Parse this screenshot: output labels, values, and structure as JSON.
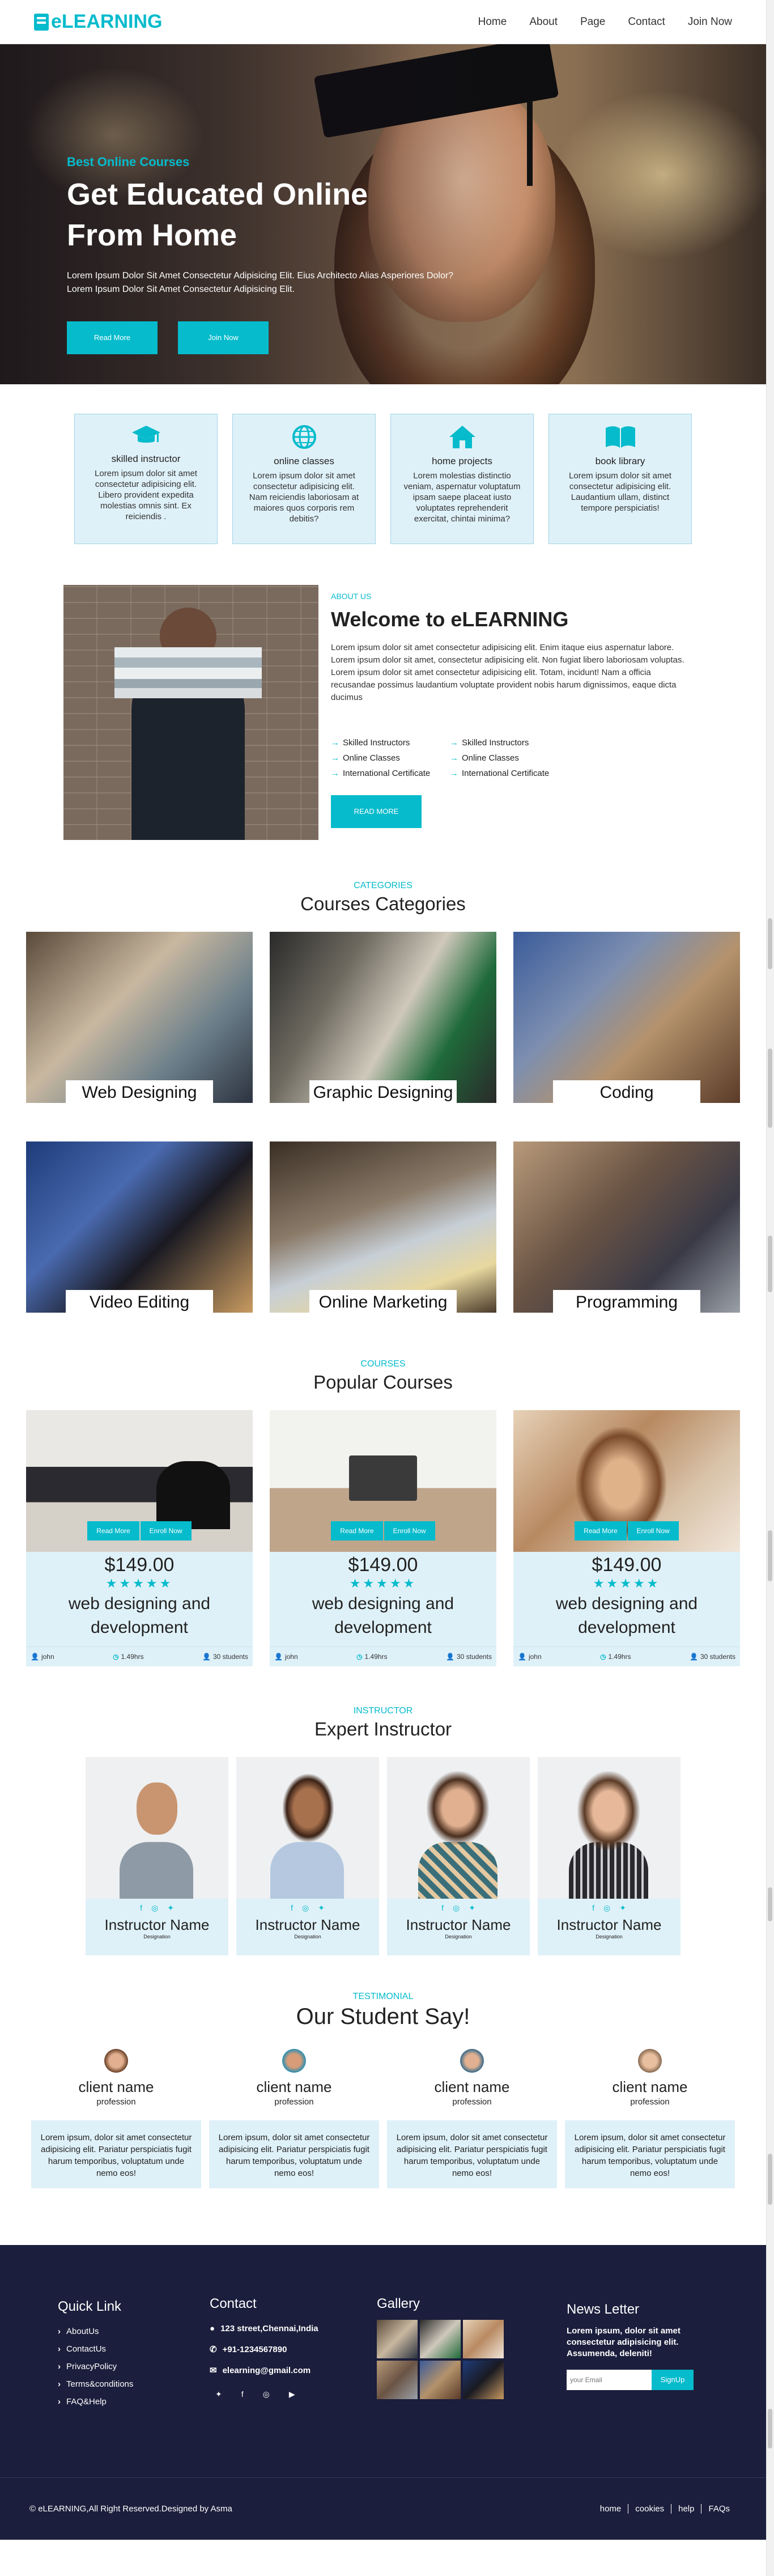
{
  "brand": "eLEARNING",
  "nav": [
    "Home",
    "About",
    "Page",
    "Contact",
    "Join Now"
  ],
  "hero": {
    "sub": "Best Online Courses",
    "title1": "Get Educated Online",
    "title2": "From Home",
    "text": "Lorem Ipsum Dolor Sit Amet Consectetur Adipisicing Elit. Eius Architecto Alias Asperiores Dolor? Lorem Ipsum Dolor Sit Amet Consectetur Adipisicing Elit.",
    "btn1": "Read More",
    "btn2": "Join Now"
  },
  "features": [
    {
      "icon": "graduation-cap-icon",
      "title": "skilled instructor",
      "text": "Lorem ipsum dolor sit amet consectetur adipisicing elit. Libero provident expedita molestias omnis sint. Ex reiciendis ."
    },
    {
      "icon": "globe-icon",
      "title": "online classes",
      "text": "Lorem ipsum dolor sit amet consectetur adipisicing elit. Nam reiciendis laboriosam at maiores quos corporis rem debitis?"
    },
    {
      "icon": "home-icon",
      "title": "home projects",
      "text": "Lorem molestias distinctio veniam, aspernatur voluptatum ipsam saepe placeat iusto voluptates reprehenderit exercitat, chintai minima?"
    },
    {
      "icon": "book-icon",
      "title": "book library",
      "text": "Lorem ipsum dolor sit amet consectetur adipisicing elit. Laudantium ullam, distinct tempore perspiciatis!"
    }
  ],
  "about": {
    "label": "ABOUT US",
    "title": "Welcome to eLEARNING",
    "p1": "Lorem ipsum dolor sit amet consectetur adipisicing elit. Enim itaque eius aspernatur labore.",
    "p2": "Lorem ipsum dolor sit amet, consectetur adipisicing elit. Non fugiat libero laboriosam voluptas.",
    "p3": "Lorem ipsum dolor sit amet consectetur adipisicing elit. Totam, incidunt! Nam a officia recusandae possimus laudantium voluptate provident nobis harum dignissimos, eaque dicta ducimus",
    "checks": [
      "Skilled Instructors",
      "Skilled Instructors",
      "Online Classes",
      "Online Classes",
      "International Certificate",
      "International Certificate"
    ],
    "btn": "READ MORE"
  },
  "categories": {
    "label": "CATEGORIES",
    "title": "Courses Categories",
    "items": [
      "Web Designing",
      "Graphic Designing",
      "Coding",
      "Video Editing",
      "Online Marketing",
      "Programming"
    ]
  },
  "courses": {
    "label": "COURSES",
    "title": "Popular Courses",
    "btn1": "Read More",
    "btn2": "Enroll Now",
    "items": [
      {
        "price": "$149.00",
        "stars": "★★★★★",
        "title1": "web designing and",
        "title2": "development",
        "author": "john",
        "hours": "1.49hrs",
        "students": "30 students"
      },
      {
        "price": "$149.00",
        "stars": "★★★★★",
        "title1": "web designing and",
        "title2": "development",
        "author": "john",
        "hours": "1.49hrs",
        "students": "30 students"
      },
      {
        "price": "$149.00",
        "stars": "★★★★★",
        "title1": "web designing and",
        "title2": "development",
        "author": "john",
        "hours": "1.49hrs",
        "students": "30 students"
      }
    ]
  },
  "instructors": {
    "label": "INSTRUCTOR",
    "title": "Expert Instructor",
    "items": [
      {
        "name": "Instructor Name",
        "designation": "Designation"
      },
      {
        "name": "Instructor Name",
        "designation": "Designation"
      },
      {
        "name": "Instructor Name",
        "designation": "Designation"
      },
      {
        "name": "Instructor Name",
        "designation": "Designation"
      }
    ]
  },
  "testimonials": {
    "label": "TESTIMONIAL",
    "title": "Our Student Say!",
    "items": [
      {
        "name": "client name",
        "profession": "profession",
        "text": "Lorem ipsum, dolor sit amet consectetur adipisicing elit. Pariatur perspiciatis fugit harum temporibus, voluptatum unde nemo eos!"
      },
      {
        "name": "client name",
        "profession": "profession",
        "text": "Lorem ipsum, dolor sit amet consectetur adipisicing elit. Pariatur perspiciatis fugit harum temporibus, voluptatum unde nemo eos!"
      },
      {
        "name": "client name",
        "profession": "profession",
        "text": "Lorem ipsum, dolor sit amet consectetur adipisicing elit. Pariatur perspiciatis fugit harum temporibus, voluptatum unde nemo eos!"
      },
      {
        "name": "client name",
        "profession": "profession",
        "text": "Lorem ipsum, dolor sit amet consectetur adipisicing elit. Pariatur perspiciatis fugit harum temporibus, voluptatum unde nemo eos!"
      }
    ]
  },
  "footer": {
    "quick": {
      "title": "Quick Link",
      "links": [
        "AboutUs",
        "ContactUs",
        "PrivacyPolicy",
        "Terms&conditions",
        "FAQ&Help"
      ]
    },
    "contact": {
      "title": "Contact",
      "address": "123 street,Chennai,India",
      "phone": "+91-1234567890",
      "email": "elearning@gmail.com"
    },
    "gallery": {
      "title": "Gallery"
    },
    "news": {
      "title": "News Letter",
      "text": "Lorem ipsum, dolor sit amet consectetur adipisicing elit. Assumenda, deleniti!",
      "placeholder": "your Email",
      "btn": "SignUp"
    },
    "copyright": "© eLEARNING,All Right Reserved.Designed by Asma",
    "bottom_links": [
      "home",
      "cookies",
      "help",
      "FAQs"
    ]
  },
  "colors": {
    "accent": "#06bbcc",
    "footer": "#1b1e3c",
    "card": "#dff1f8"
  }
}
